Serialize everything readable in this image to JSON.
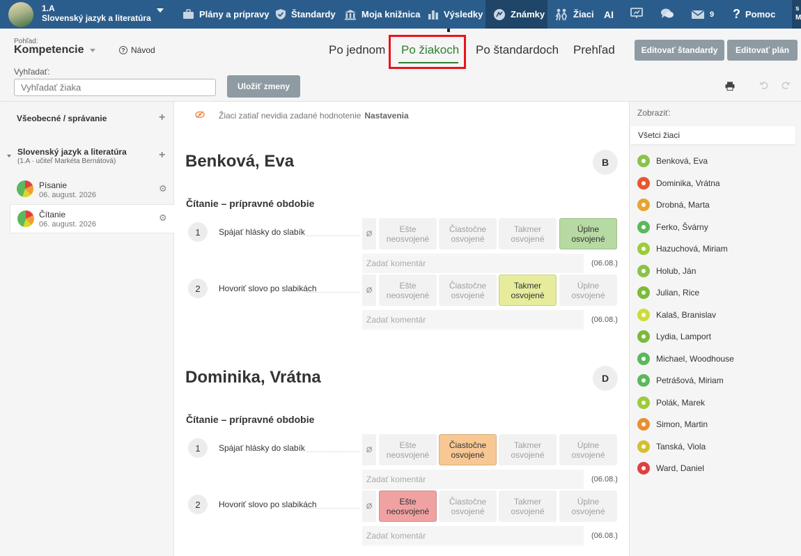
{
  "topnav": {
    "class_code": "1.A",
    "class_subject": "Slovenský jazyk a literatúra",
    "items": [
      {
        "label": "Plány a prípravy",
        "icon": "briefcase-icon"
      },
      {
        "label": "Štandardy",
        "icon": "shield-icon"
      },
      {
        "label": "Moja knižnica",
        "icon": "library-icon"
      },
      {
        "label": "Výsledky",
        "icon": "bar-chart-icon"
      },
      {
        "label": "Známky",
        "icon": "grade-icon"
      },
      {
        "label": "Žiaci",
        "icon": "students-icon"
      }
    ],
    "ai_label": "AI",
    "messages_count": "9",
    "help_label": "Pomoc",
    "user_initials_top": "s",
    "user_initials_bottom": "M",
    "colors": {
      "bar": "#2b5d8c",
      "active": "#1f4568"
    }
  },
  "view": {
    "caption": "Pohľad:",
    "value": "Kompetencie",
    "guide_label": "Návod"
  },
  "search": {
    "label": "Vyhľadať:",
    "placeholder": "Vyhľadať žiaka"
  },
  "save_button": "Uložiť zmeny",
  "tabs": [
    {
      "label": "Po jednom",
      "active": false
    },
    {
      "label": "Po žiakoch",
      "active": true
    },
    {
      "label": "Po štandardoch",
      "active": false
    },
    {
      "label": "Prehľad",
      "active": false
    }
  ],
  "buttons": {
    "edit_standards": "Editovať štandardy",
    "edit_plan": "Editovať plán"
  },
  "sidebar": {
    "general_label": "Všeobecné / správanie",
    "subject": "Slovenský jazyk a literatúra",
    "subject_meta": "(1.A · učiteľ Markéta Bernátová)",
    "assessments": [
      {
        "name": "Písanie",
        "date": "06. august. 2026"
      },
      {
        "name": "Čítanie",
        "date": "06. august. 2026"
      }
    ]
  },
  "notice": {
    "text": "Žiaci zatiaľ nevidia zadané hodnotenie",
    "link": "Nastavenia"
  },
  "grade_labels": {
    "null": "Ø",
    "options": [
      "Ešte neosvojené",
      "Čiastočne osvojené",
      "Takmer osvojené",
      "Úplne osvojené"
    ],
    "colors": [
      "#f0a2a2",
      "#f7c894",
      "#e6ec9c",
      "#b7d9a3"
    ]
  },
  "comment_placeholder": "Zadať komentár",
  "students_cards": [
    {
      "name": "Benková, Eva",
      "grade": "B",
      "section": "Čítanie – prípravné obdobie",
      "criteria": [
        {
          "num": "1",
          "label": "Spájať hlásky do slabík",
          "selected": 3,
          "date": "(06.08.)"
        },
        {
          "num": "2",
          "label": "Hovoriť slovo po slabikách",
          "selected": 2,
          "date": "(06.08.)"
        }
      ]
    },
    {
      "name": "Dominika, Vrátna",
      "grade": "D",
      "section": "Čítanie – prípravné obdobie",
      "criteria": [
        {
          "num": "1",
          "label": "Spájať hlásky do slabík",
          "selected": 1,
          "date": "(06.08.)"
        },
        {
          "num": "2",
          "label": "Hovoriť slovo po slabikách",
          "selected": 0,
          "date": "(06.08.)"
        }
      ]
    }
  ],
  "right_panel": {
    "show_label": "Zobraziť:",
    "filter_value": "Všetci žiaci",
    "students": [
      {
        "name": "Benková, Eva",
        "color": "#8bc34a"
      },
      {
        "name": "Dominika, Vrátna",
        "color": "#e8572e"
      },
      {
        "name": "Drobná, Marta",
        "color": "#e8a42e"
      },
      {
        "name": "Ferko, Švárny",
        "color": "#5cb85c"
      },
      {
        "name": "Hazuchová, Miriam",
        "color": "#9ccc3a"
      },
      {
        "name": "Holub, Ján",
        "color": "#8bc34a"
      },
      {
        "name": "Julian, Rice",
        "color": "#7cba3a"
      },
      {
        "name": "Kalaš, Branislav",
        "color": "#cddc39"
      },
      {
        "name": "Lydia, Lamport",
        "color": "#7cba3a"
      },
      {
        "name": "Michael, Woodhouse",
        "color": "#5cb85c"
      },
      {
        "name": "Petrášová, Miriam",
        "color": "#5cb85c"
      },
      {
        "name": "Polák, Marek",
        "color": "#9ccc3a"
      },
      {
        "name": "Simon, Martin",
        "color": "#e8902e"
      },
      {
        "name": "Tanská, Viola",
        "color": "#d4c02e"
      },
      {
        "name": "Ward, Daniel",
        "color": "#e04040"
      }
    ]
  }
}
